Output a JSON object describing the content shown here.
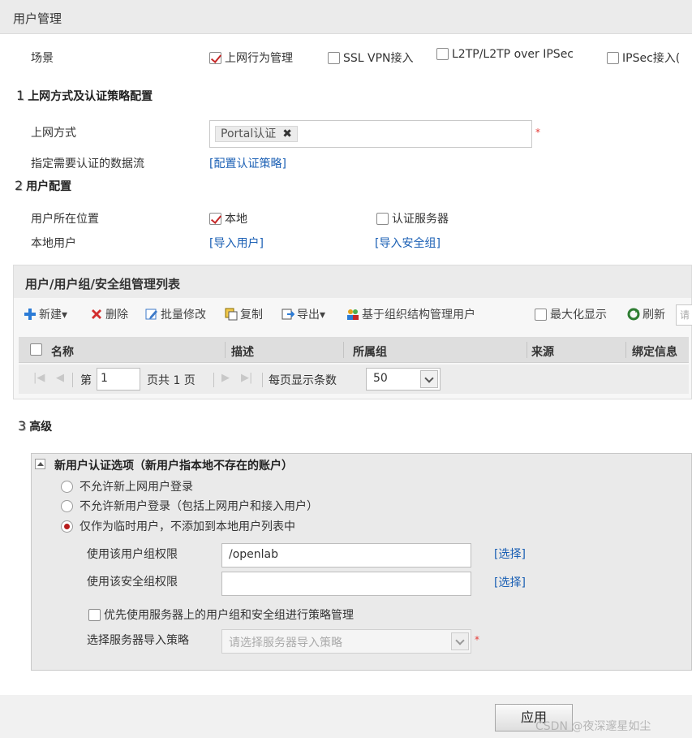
{
  "header": {
    "title": "用户管理"
  },
  "scene": {
    "label": "场景",
    "options": [
      {
        "label": "上网行为管理",
        "checked": true
      },
      {
        "label": "SSL VPN接入",
        "checked": false
      },
      {
        "label": "L2TP/L2TP over IPSec",
        "checked": false
      },
      {
        "label": "IPSec接入(",
        "checked": false
      }
    ]
  },
  "section1": {
    "num": "1",
    "title": "上网方式及认证策略配置",
    "access_label": "上网方式",
    "access_tag": "Portal认证",
    "tag_remove": "✖",
    "required": "*",
    "flow_label": "指定需要认证的数据流",
    "flow_link": "[配置认证策略]"
  },
  "section2": {
    "num": "2",
    "title": "用户配置",
    "location_label": "用户所在位置",
    "location_local": {
      "label": "本地",
      "checked": true
    },
    "location_server": {
      "label": "认证服务器",
      "checked": false
    },
    "local_user_label": "本地用户",
    "import_users_link": "[导入用户]",
    "import_groups_link": "[导入安全组]"
  },
  "list": {
    "title": "用户/用户组/安全组管理列表",
    "toolbar": {
      "new": "新建▾",
      "delete": "删除",
      "batch_edit": "批量修改",
      "copy": "复制",
      "export": "导出▾",
      "org_manage": "基于组织结构管理用户",
      "maximize": "最大化显示",
      "refresh": "刷新",
      "search_placeholder": "请"
    },
    "columns": [
      "名称",
      "描述",
      "所属组",
      "来源",
      "绑定信息"
    ],
    "pager": {
      "page_prefix": "第",
      "page_value": "1",
      "page_total": "页共 1 页",
      "per_page_label": "每页显示条数",
      "per_page_value": "50"
    }
  },
  "section3": {
    "num": "3",
    "title": "高级",
    "panel_title": "新用户认证选项（新用户指本地不存在的账户）",
    "radios": [
      {
        "label": "不允许新上网用户登录",
        "selected": false
      },
      {
        "label": "不允许新用户登录（包括上网用户和接入用户）",
        "selected": false
      },
      {
        "label": "仅作为临时用户，不添加到本地用户列表中",
        "selected": true
      }
    ],
    "group_perm_label": "使用该用户组权限",
    "group_perm_value": "/openlab",
    "group_perm_link": "[选择]",
    "secgroup_perm_label": "使用该安全组权限",
    "secgroup_perm_value": "",
    "secgroup_perm_link": "[选择]",
    "prefer_server_label": "优先使用服务器上的用户组和安全组进行策略管理",
    "import_policy_label": "选择服务器导入策略",
    "import_policy_placeholder": "请选择服务器导入策略",
    "required": "*"
  },
  "footer": {
    "apply": "应用",
    "watermark": "CSDN @夜深邃星如尘"
  },
  "colors": {
    "link": "#1a5fb4",
    "check": "#c62828",
    "required": "#e53935"
  }
}
